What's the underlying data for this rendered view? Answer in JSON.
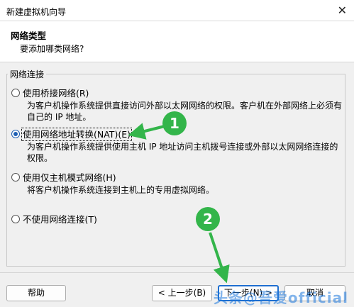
{
  "window": {
    "title": "新建虚拟机向导",
    "close_glyph": "✕"
  },
  "header": {
    "title": "网络类型",
    "subtitle": "要添加哪类网络?"
  },
  "group": {
    "title": "网络连接"
  },
  "options": [
    {
      "label": "使用桥接网络(R)",
      "desc": "为客户机操作系统提供直接访问外部以太网网络的权限。客户机在外部网络上必须有自己的 IP 地址。",
      "checked": false
    },
    {
      "label": "使用网络地址转换(NAT)(E)",
      "desc": "为客户机操作系统提供使用主机 IP 地址访问主机拨号连接或外部以太网网络连接的权限。",
      "checked": true
    },
    {
      "label": "使用仅主机模式网络(H)",
      "desc": "将客户机操作系统连接到主机上的专用虚拟网络。",
      "checked": false
    },
    {
      "label": "不使用网络连接(T)",
      "desc": "",
      "checked": false
    }
  ],
  "buttons": {
    "help": "帮助",
    "back": "< 上一步(B)",
    "next": "下一步(N) >",
    "cancel": "取消"
  },
  "annotations": {
    "marker1": "1",
    "marker2": "2",
    "color": "#33b54a"
  },
  "watermark": "头条@吾爱official"
}
